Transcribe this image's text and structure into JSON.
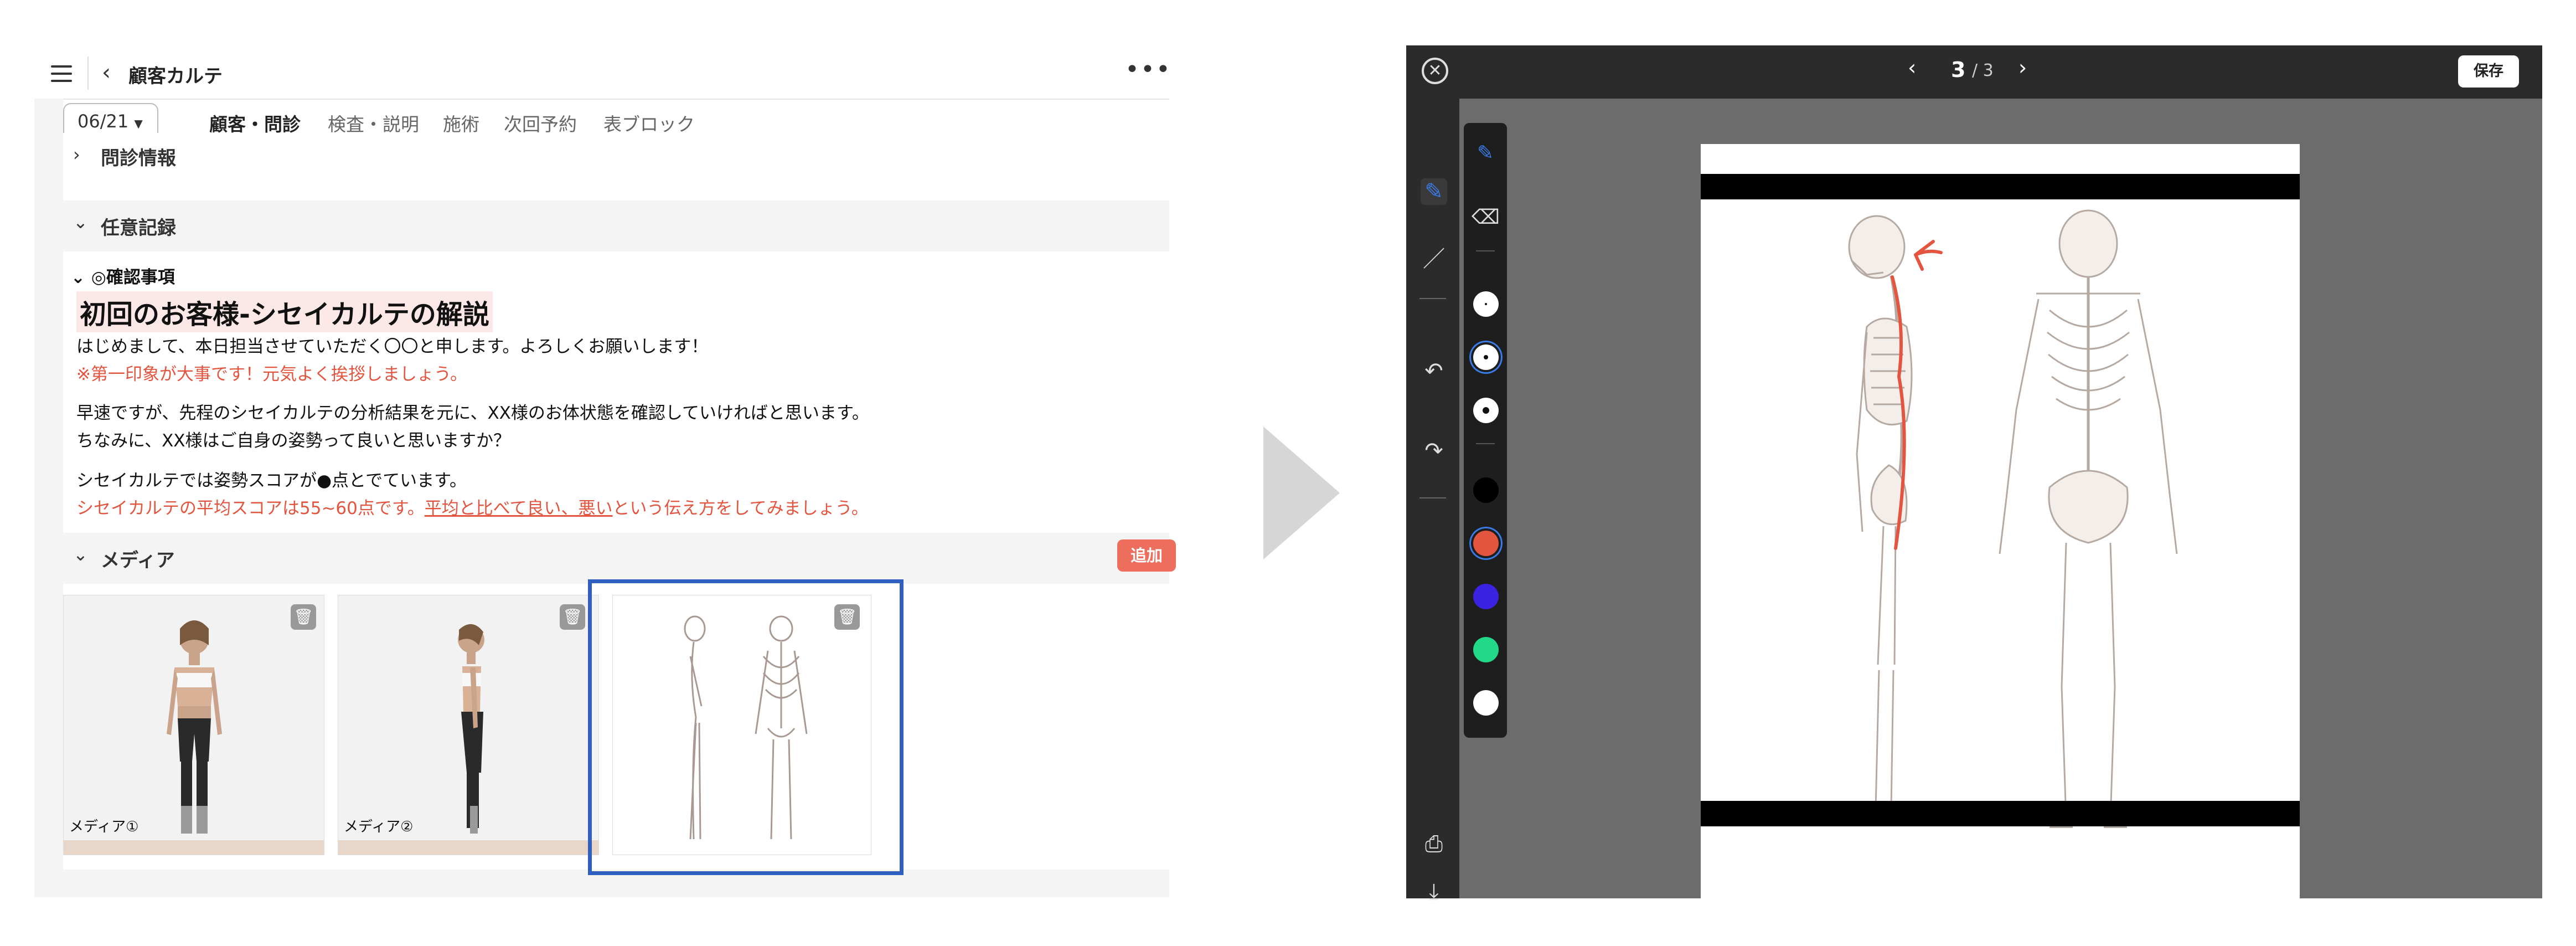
{
  "left": {
    "header": {
      "title": "顧客カルテ",
      "back_icon": "chevron-left-icon",
      "menu_icon": "hamburger-icon",
      "more_icon": "more-icon"
    },
    "tabs": {
      "date": "06/21",
      "items": [
        "顧客・問診",
        "検査・説明",
        "施術",
        "次回予約",
        "表ブロック"
      ],
      "active_index": 0
    },
    "sections": {
      "interview": "問診情報",
      "optional": "任意記録",
      "confirm": "◎確認事項",
      "media": "メディア"
    },
    "script": {
      "headline": "初回のお客様-シセイカルテの解説",
      "line1": "はじめまして、本日担当させていただく〇〇と申します。よろしくお願いします！",
      "line2": "※第一印象が大事です！元気よく挨拶しましょう。",
      "line3": "早速ですが、先程のシセイカルテの分析結果を元に、XX様のお体状態を確認していければと思います。",
      "line4": "ちなみに、XX様はご自身の姿勢って良いと思いますか？",
      "line5": "シセイカルテでは姿勢スコアが●点とでています。",
      "line6_a": "シセイカルテの平均スコアは55~60点です。",
      "line6_b": "平均と比べて良い、悪い",
      "line6_c": "という伝え方をしてみましょう。"
    },
    "media": {
      "add_label": "追加",
      "items": [
        {
          "label": "メディア①"
        },
        {
          "label": "メディア②"
        },
        {
          "label": ""
        }
      ]
    }
  },
  "viewer": {
    "page_current": "3",
    "page_total": "/ 3",
    "save_label": "保存",
    "colors": [
      "#000000",
      "#e4553f",
      "#3a22e0",
      "#22d98a",
      "#ffffff"
    ],
    "selected_color": "#e4553f",
    "accent": "#3a7be8"
  }
}
